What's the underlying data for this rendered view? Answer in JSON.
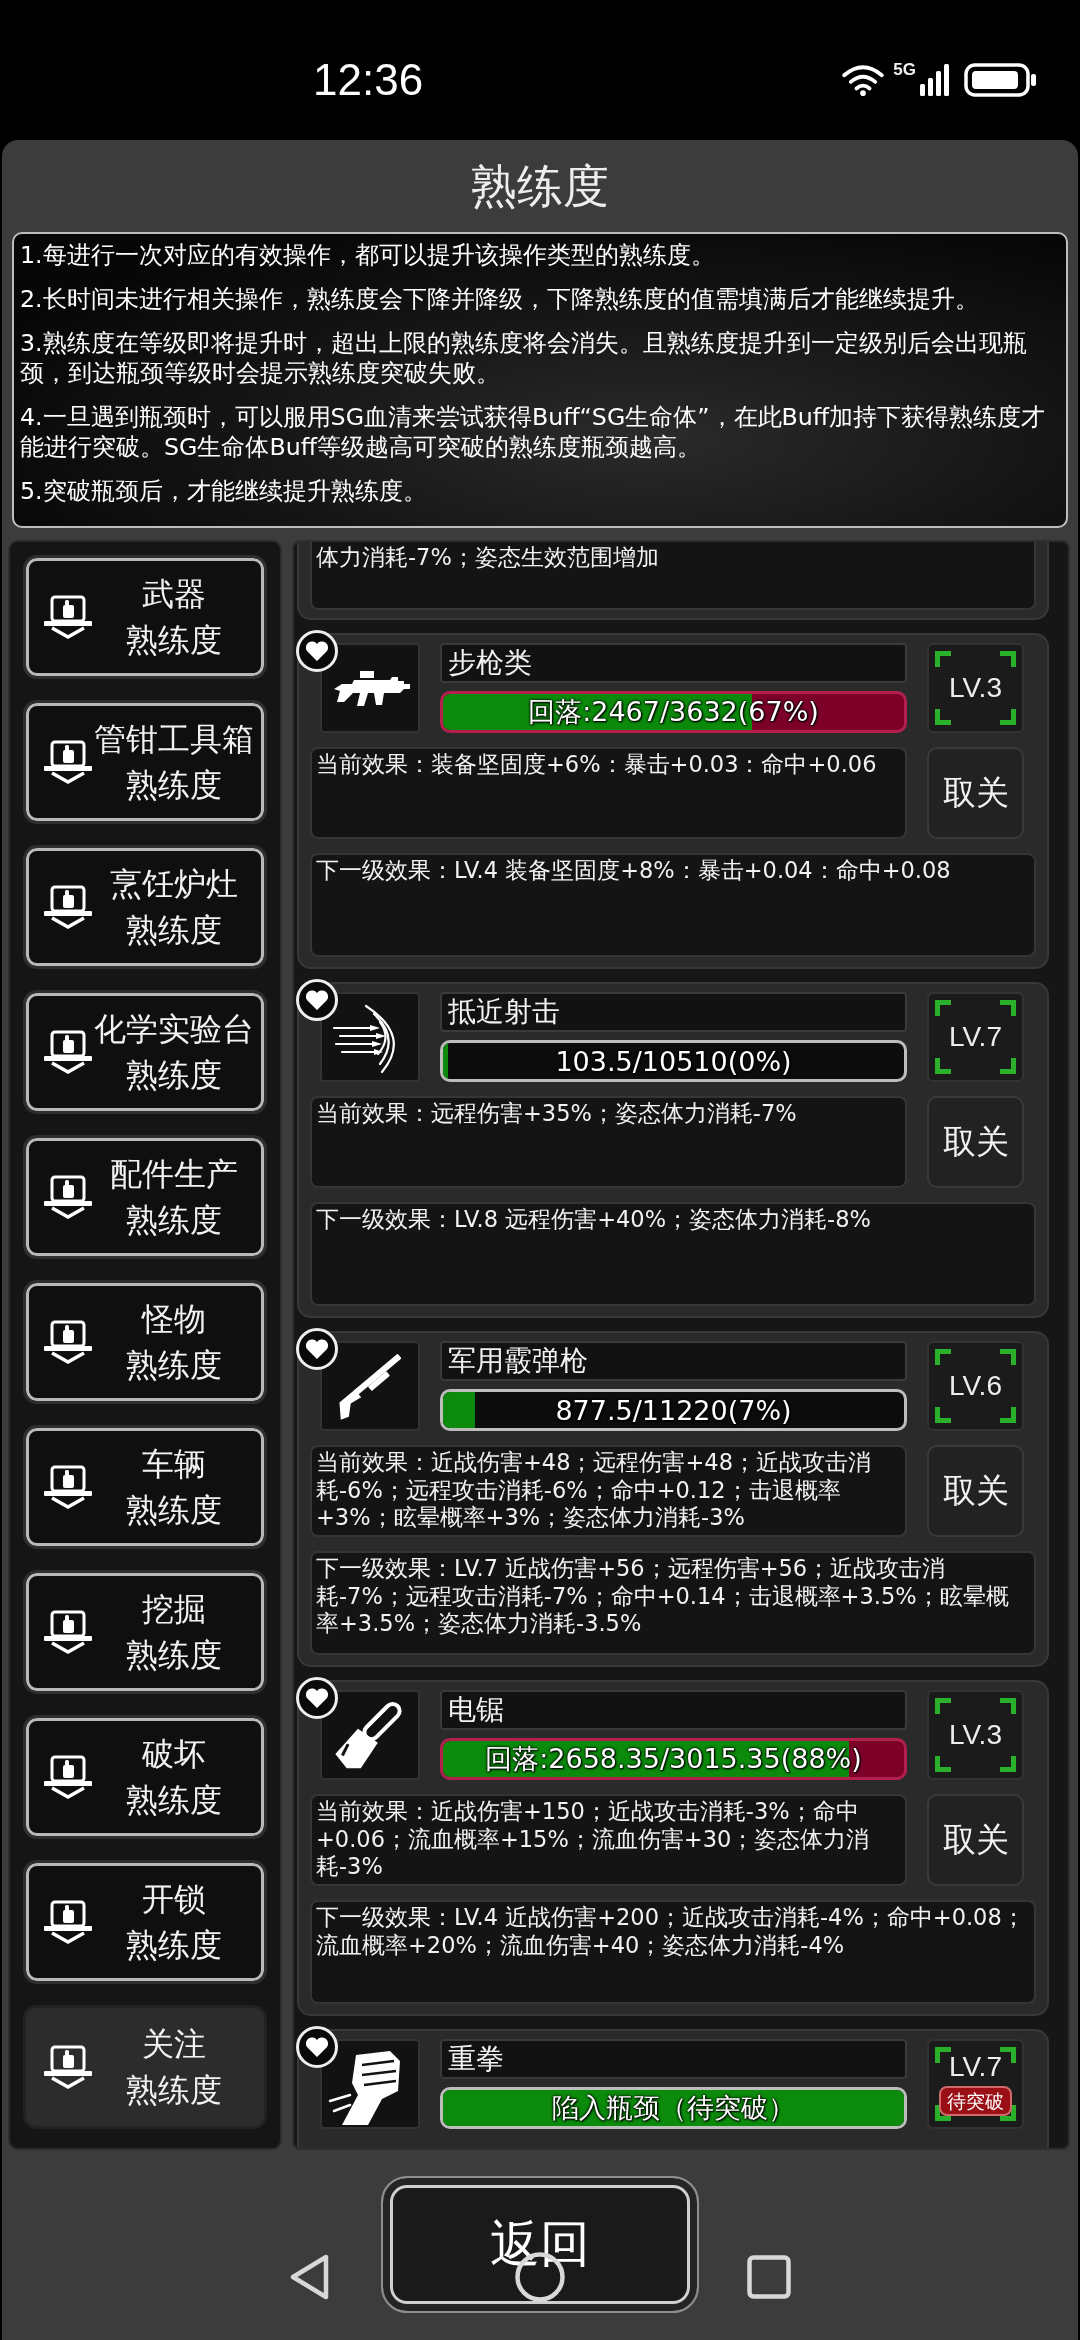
{
  "status_bar": {
    "time": "12:36",
    "network": "5G"
  },
  "title": "熟练度",
  "info": [
    "1.每进行一次对应的有效操作，都可以提升该操作类型的熟练度。",
    "2.长时间未进行相关操作，熟练度会下降并降级，下降熟练度的值需填满后才能继续提升。",
    "3.熟练度在等级即将提升时，超出上限的熟练度将会消失。且熟练度提升到一定级别后会出现瓶颈，到达瓶颈等级时会提示熟练度突破失败。",
    "4.一旦遇到瓶颈时，可以服用SG血清来尝试获得Buff“SG生命体”，在此Buff加持下获得熟练度才能进行突破。SG生命体Buff等级越高可突破的熟练度瓶颈越高。",
    "5.突破瓶颈后，才能继续提升熟练度。"
  ],
  "sidebar": {
    "items": [
      {
        "name": "武器",
        "suffix": "熟练度",
        "selected": false
      },
      {
        "name": "管钳工具箱",
        "suffix": "熟练度",
        "selected": false
      },
      {
        "name": "烹饪炉灶",
        "suffix": "熟练度",
        "selected": false
      },
      {
        "name": "化学实验台",
        "suffix": "熟练度",
        "selected": false
      },
      {
        "name": "配件生产",
        "suffix": "熟练度",
        "selected": false
      },
      {
        "name": "怪物",
        "suffix": "熟练度",
        "selected": false
      },
      {
        "name": "车辆",
        "suffix": "熟练度",
        "selected": false
      },
      {
        "name": "挖掘",
        "suffix": "熟练度",
        "selected": false
      },
      {
        "name": "破坏",
        "suffix": "熟练度",
        "selected": false
      },
      {
        "name": "开锁",
        "suffix": "熟练度",
        "selected": false
      },
      {
        "name": "关注",
        "suffix": "熟练度",
        "selected": true
      }
    ]
  },
  "list": {
    "partial_next_effect": "体力消耗-7%；姿态生效范围增加",
    "cards": [
      {
        "name": "步枪类",
        "favorited": true,
        "progress": {
          "kind": "decay",
          "text": "回落:2467/3632(67%)",
          "level": 0.67
        },
        "rank": "LV.3",
        "current_effect": "当前效果：装备坚固度+6%：暴击+0.03：命中+0.06",
        "unfollow": "取关",
        "next_effect": "下一级效果：LV.4 装备坚固度+8%：暴击+0.04：命中+0.08"
      },
      {
        "name": "抵近射击",
        "favorited": true,
        "progress": {
          "kind": "normal",
          "text": "103.5/10510(0%)",
          "level": 0.01
        },
        "rank": "LV.7",
        "current_effect": "当前效果：远程伤害+35%；姿态体力消耗-7%",
        "unfollow": "取关",
        "next_effect": "下一级效果：LV.8 远程伤害+40%；姿态体力消耗-8%"
      },
      {
        "name": "军用霰弹枪",
        "favorited": true,
        "progress": {
          "kind": "normal",
          "text": "877.5/11220(7%)",
          "level": 0.07
        },
        "rank": "LV.6",
        "current_effect": "当前效果：近战伤害+48；远程伤害+48；近战攻击消耗-6%；远程攻击消耗-6%；命中+0.12；击退概率+3%；眩晕概率+3%；姿态体力消耗-3%",
        "unfollow": "取关",
        "next_effect": "下一级效果：LV.7 近战伤害+56；远程伤害+56；近战攻击消耗-7%；远程攻击消耗-7%；命中+0.14；击退概率+3.5%；眩晕概率+3.5%；姿态体力消耗-3.5%"
      },
      {
        "name": "电锯",
        "favorited": true,
        "progress": {
          "kind": "decay",
          "text": "回落:2658.35/3015.35(88%)",
          "level": 0.88
        },
        "rank": "LV.3",
        "current_effect": "当前效果：近战伤害+150；近战攻击消耗-3%；命中+0.06；流血概率+15%；流血伤害+30；姿态体力消耗-3%",
        "unfollow": "取关",
        "next_effect": "下一级效果：LV.4 近战伤害+200；近战攻击消耗-4%；命中+0.08；流血概率+20%；流血伤害+40；姿态体力消耗-4%"
      },
      {
        "name": "重拳",
        "favorited": true,
        "progress": {
          "kind": "normal",
          "text": "陷入瓶颈（待突破）",
          "level": 1
        },
        "rank": "LV.7",
        "badge": "待突破"
      }
    ]
  },
  "back_button": "返回"
}
